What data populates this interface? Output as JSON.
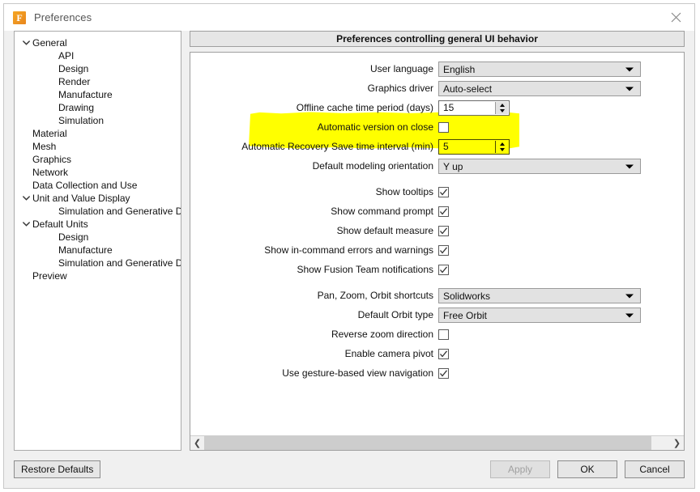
{
  "window": {
    "title": "Preferences",
    "app_icon": "fusion-f-icon",
    "icon_letter": "F",
    "close_icon": "close-icon",
    "accent_color": "#f5a623",
    "highlight_color": "#ffff00"
  },
  "sidebar": {
    "items": [
      {
        "label": "General",
        "level": 0,
        "expandable": true,
        "expanded": true
      },
      {
        "label": "API",
        "level": 1,
        "expandable": false,
        "expanded": false
      },
      {
        "label": "Design",
        "level": 1,
        "expandable": false,
        "expanded": false
      },
      {
        "label": "Render",
        "level": 1,
        "expandable": false,
        "expanded": false
      },
      {
        "label": "Manufacture",
        "level": 1,
        "expandable": false,
        "expanded": false
      },
      {
        "label": "Drawing",
        "level": 1,
        "expandable": false,
        "expanded": false
      },
      {
        "label": "Simulation",
        "level": 1,
        "expandable": false,
        "expanded": false
      },
      {
        "label": "Material",
        "level": 0,
        "expandable": false,
        "expanded": false
      },
      {
        "label": "Mesh",
        "level": 0,
        "expandable": false,
        "expanded": false
      },
      {
        "label": "Graphics",
        "level": 0,
        "expandable": false,
        "expanded": false
      },
      {
        "label": "Network",
        "level": 0,
        "expandable": false,
        "expanded": false
      },
      {
        "label": "Data Collection and Use",
        "level": 0,
        "expandable": false,
        "expanded": false
      },
      {
        "label": "Unit and Value Display",
        "level": 0,
        "expandable": true,
        "expanded": true
      },
      {
        "label": "Simulation and Generative Design",
        "level": 1,
        "expandable": false,
        "expanded": false
      },
      {
        "label": "Default Units",
        "level": 0,
        "expandable": true,
        "expanded": true
      },
      {
        "label": "Design",
        "level": 1,
        "expandable": false,
        "expanded": false
      },
      {
        "label": "Manufacture",
        "level": 1,
        "expandable": false,
        "expanded": false
      },
      {
        "label": "Simulation and Generative Design",
        "level": 1,
        "expandable": false,
        "expanded": false
      },
      {
        "label": "Preview",
        "level": 0,
        "expandable": false,
        "expanded": false
      }
    ]
  },
  "panel": {
    "header": "Preferences controlling general UI behavior",
    "fields": {
      "user_language": {
        "label": "User language",
        "value": "English",
        "type": "combo"
      },
      "graphics_driver": {
        "label": "Graphics driver",
        "value": "Auto-select",
        "type": "combo"
      },
      "offline_cache": {
        "label": "Offline cache time period (days)",
        "value": "15",
        "type": "spinner"
      },
      "auto_version_on_close": {
        "label": "Automatic version on close",
        "checked": false,
        "type": "checkbox",
        "highlighted": true
      },
      "auto_recovery_interval": {
        "label": "Automatic Recovery Save time interval (min)",
        "value": "5",
        "type": "spinner",
        "highlighted": true
      },
      "default_modeling_orientation": {
        "label": "Default modeling orientation",
        "value": "Y up",
        "type": "combo"
      },
      "show_tooltips": {
        "label": "Show tooltips",
        "checked": true,
        "type": "checkbox"
      },
      "show_command_prompt": {
        "label": "Show command prompt",
        "checked": true,
        "type": "checkbox"
      },
      "show_default_measure": {
        "label": "Show default measure",
        "checked": true,
        "type": "checkbox"
      },
      "show_in_command_errors": {
        "label": "Show in-command errors and warnings",
        "checked": true,
        "type": "checkbox"
      },
      "show_fusion_team_notifications": {
        "label": "Show Fusion Team notifications",
        "checked": true,
        "type": "checkbox"
      },
      "pan_zoom_orbit_shortcuts": {
        "label": "Pan, Zoom, Orbit shortcuts",
        "value": "Solidworks",
        "type": "combo"
      },
      "default_orbit_type": {
        "label": "Default Orbit type",
        "value": "Free Orbit",
        "type": "combo"
      },
      "reverse_zoom_direction": {
        "label": "Reverse zoom direction",
        "checked": false,
        "type": "checkbox"
      },
      "enable_camera_pivot": {
        "label": "Enable camera pivot",
        "checked": true,
        "type": "checkbox"
      },
      "use_gesture_navigation": {
        "label": "Use gesture-based view navigation",
        "checked": true,
        "type": "checkbox"
      }
    },
    "scrollbar": {
      "left_icon": "chevron-left-icon",
      "right_icon": "chevron-right-icon"
    }
  },
  "footer": {
    "restore_defaults": "Restore Defaults",
    "apply": "Apply",
    "apply_enabled": false,
    "ok": "OK",
    "cancel": "Cancel"
  }
}
